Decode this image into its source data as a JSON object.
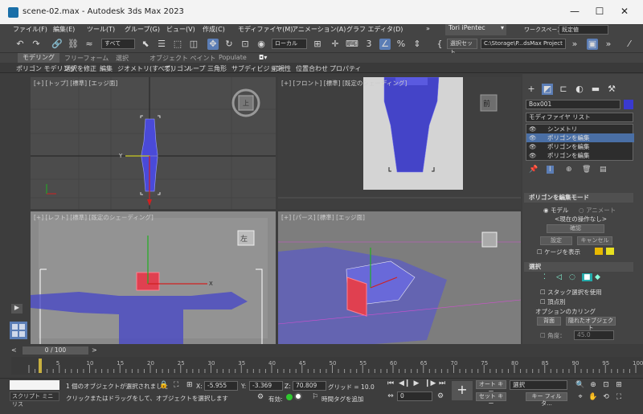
{
  "window": {
    "title": "scene-02.max - Autodesk 3ds Max 2023",
    "min": "—",
    "max": "☐",
    "close": "✕"
  },
  "menu": [
    "ファイル(F)",
    "編集(E)",
    "ツール(T)",
    "グループ(G)",
    "ビュー(V)",
    "作成(C)",
    "モディファイヤ(M)",
    "アニメーション(A)",
    "グラフ エディタ(D)",
    "»"
  ],
  "user": {
    "name": "Tori iPentec"
  },
  "workspace": {
    "label": "ワークスペース:",
    "value": "既定値"
  },
  "toolbar": {
    "filter": "すべて",
    "coord_system": "ローカル",
    "selection_set": "選択セット",
    "project_path": "C:\\Storage\\P...dsMax Project"
  },
  "ribbon": {
    "tabs": [
      "モデリング",
      "フリーフォーム",
      "選択",
      "オブジェクト ペイント",
      "Populate"
    ],
    "active_tab": "モデリング",
    "subitems": [
      "ポリゴン モデリング",
      "選択を修正",
      "編集",
      "ジオメトリ(すべて)",
      "ポリゴン",
      "ループ",
      "三角形",
      "サブディビジョン",
      "可視性",
      "位置合わせ",
      "プロパティ"
    ]
  },
  "viewports": {
    "top": {
      "label": "[+] [トップ] [標準] [エッジ面]"
    },
    "front": {
      "label": "[+] [フロント] [標準] [既定のシェーディング]",
      "cube": "前"
    },
    "left": {
      "label": "[+] [レフト] [標準] [既定のシェーディング]",
      "cube": "左"
    },
    "persp": {
      "label": "[+] [パース] [標準] [エッジ面]"
    }
  },
  "command_panel": {
    "object_name": "Box001",
    "object_color": "#3a3ad0",
    "modifier_list": "モディファイヤ リスト",
    "stack": [
      "シンメトリ",
      "ポリゴンを編集",
      "ポリゴンを編集",
      "ポリゴンを編集"
    ],
    "rollout_edit_mode": "ポリゴンを編集モード",
    "mode_model": "モデル",
    "mode_animate": "アニメート",
    "current_op": "<現在の操作なし>",
    "commit": "確認",
    "settings": "設定",
    "cancel": "キャンセル",
    "show_cage": "ケージを表示",
    "rollout_selection": "選択",
    "by_stack": "スタック選択を使用",
    "by_vertex": "頂点別",
    "culling_label": "オプションのカリング",
    "backface": "背面",
    "occluded": "隠れたオブジェクト",
    "angle_label": "角度：",
    "angle_value": "45.0"
  },
  "timeline": {
    "frame_display": "0 / 100",
    "ticks": [
      "5",
      "10",
      "15",
      "20",
      "25",
      "30",
      "35",
      "40",
      "45",
      "50",
      "55",
      "60",
      "65",
      "70",
      "75",
      "80",
      "85",
      "90",
      "95",
      "100"
    ]
  },
  "status": {
    "selected_msg": "1 個のオブジェクトが選択されました",
    "hint_msg": "クリックまたはドラッグをして、オブジェクトを選択します",
    "script_label": "スクリプト ミニ リス",
    "x_label": "X:",
    "x_value": "-5.955",
    "y_label": "Y:",
    "y_value": "-3.369",
    "z_label": "Z:",
    "z_value": "70.809",
    "grid": "グリッド = 10.0",
    "enabled": "有効:",
    "add_time_tag": "時間タグを追加",
    "auto_key": "オート キー",
    "set_key": "セット キー",
    "key_mode": "選択",
    "key_filter": "キー フィルタ...",
    "frame_input": "0"
  }
}
